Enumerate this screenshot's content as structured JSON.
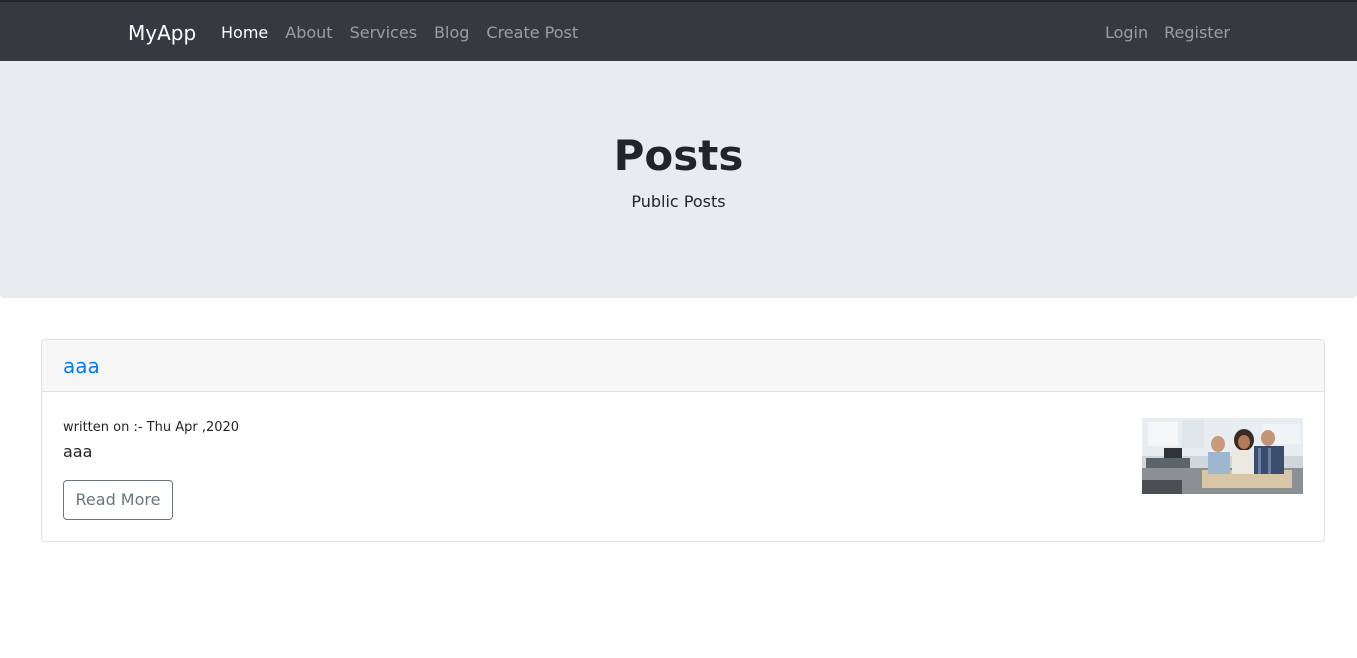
{
  "navbar": {
    "brand": "MyApp",
    "left_links": [
      "Home",
      "About",
      "Services",
      "Blog",
      "Create Post"
    ],
    "right_links": [
      "Login",
      "Register"
    ],
    "active": "Home"
  },
  "jumbotron": {
    "title": "Posts",
    "subtitle": "Public Posts"
  },
  "posts": [
    {
      "title": "aaa",
      "meta": "written on :- Thu Apr ,2020",
      "excerpt": "aaa",
      "button": "Read More"
    }
  ],
  "colors": {
    "navbar_bg": "#343a40",
    "jumbotron_bg": "#e9ecef",
    "link": "#007bff",
    "button_outline": "#6c757d"
  }
}
